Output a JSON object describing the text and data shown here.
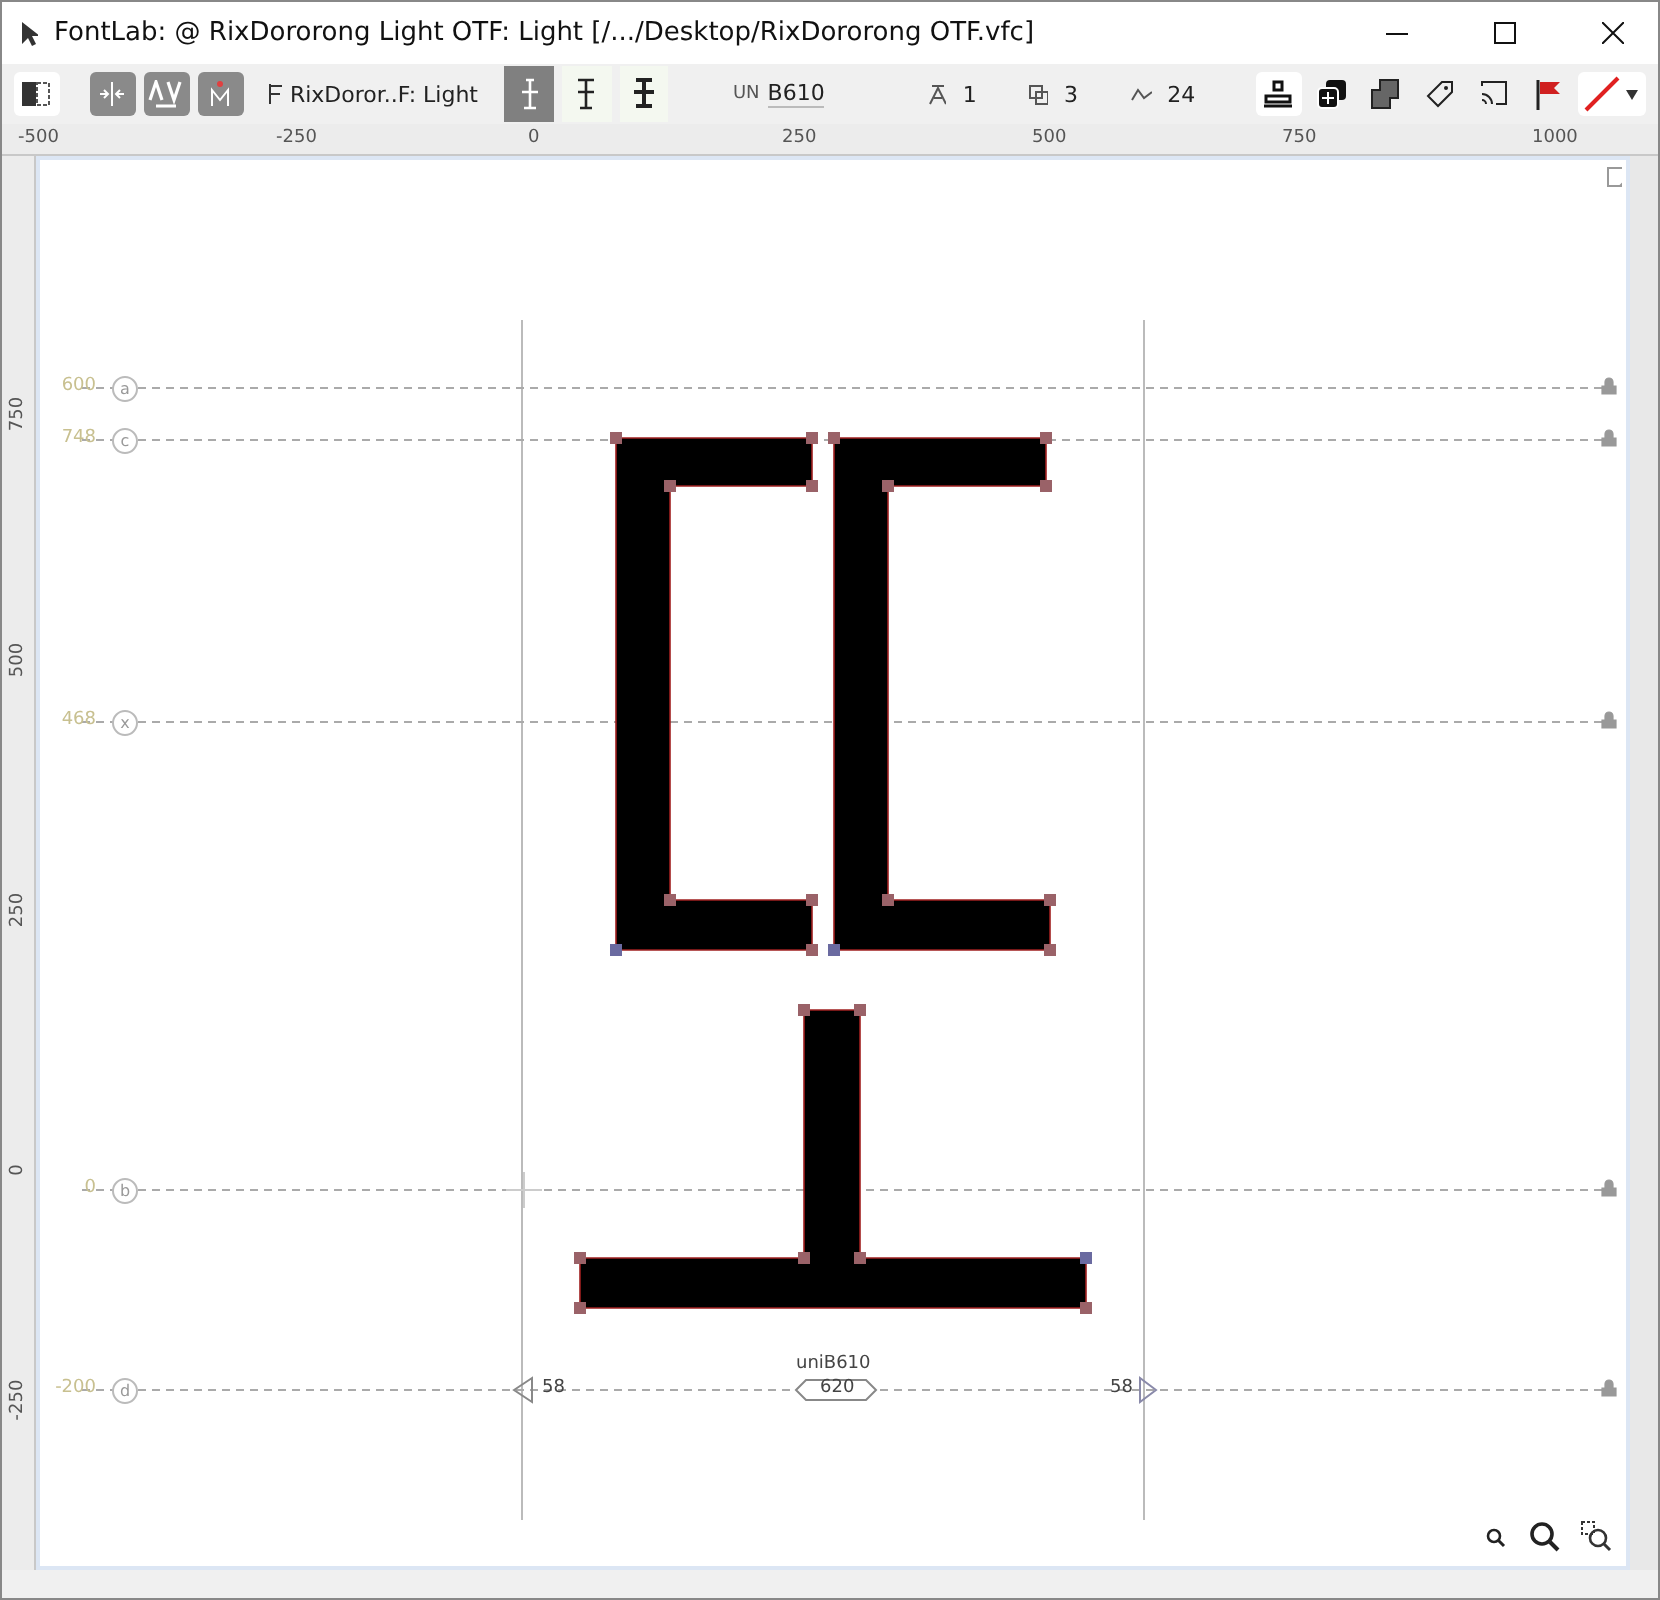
{
  "window": {
    "title": "FontLab:  @ RixDororong Light OTF: Light [/.../Desktop/RixDororong OTF.vfc]"
  },
  "toolbar": {
    "panel_toggle": {
      "selected": true
    },
    "tools": [
      {
        "kind": "metrics"
      },
      {
        "kind": "kerning"
      },
      {
        "kind": "mark"
      }
    ],
    "font_name": "RixDoror..F: Light",
    "modes": [
      {
        "selected": true
      },
      {
        "selected": false
      },
      {
        "selected": false
      }
    ],
    "unicode_label": "UN",
    "unicode": "B610",
    "stats": [
      {
        "kind": "glyphs",
        "value": "1"
      },
      {
        "kind": "contours",
        "value": "3"
      },
      {
        "kind": "nodes",
        "value": "24"
      }
    ],
    "right_tools": [
      {
        "kind": "stack",
        "selected": true
      },
      {
        "kind": "add",
        "selected": false
      },
      {
        "kind": "merge",
        "selected": false
      },
      {
        "kind": "tag",
        "selected": false
      },
      {
        "kind": "cast",
        "selected": false
      },
      {
        "kind": "flag",
        "selected": false
      }
    ]
  },
  "rulers": {
    "horizontal": [
      "-500",
      "-250",
      "0",
      "250",
      "500",
      "750",
      "1000"
    ],
    "vertical": [
      "750",
      "500",
      "250",
      "0",
      "-250"
    ]
  },
  "guides": [
    {
      "value": "600",
      "letter": "a"
    },
    {
      "value": "748",
      "letter": "c"
    },
    {
      "value": "468",
      "letter": "x"
    },
    {
      "value": "0",
      "letter": "b"
    },
    {
      "value": "-200",
      "letter": "d"
    }
  ],
  "glyph": {
    "name": "uniB610",
    "advance": "620",
    "left_sidebearing": "58",
    "right_sidebearing": "58"
  }
}
